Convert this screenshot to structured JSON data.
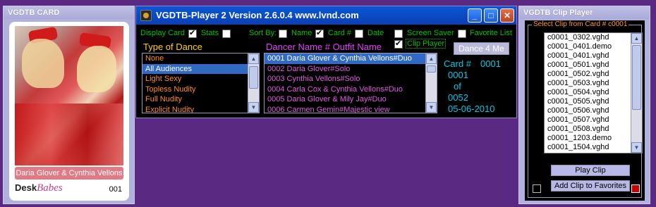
{
  "card_window": {
    "title": "VGDTB CARD",
    "caption": "Daria Glover & Cynthia Vellons",
    "logo_part1": "Desk",
    "logo_part2": "Babes",
    "card_number": "001"
  },
  "player_window": {
    "title": "VGDTB-Player 2  Version 2.6.0.4  www.lvnd.com",
    "controls": {
      "display_card": {
        "label": "Display Card",
        "checked": true
      },
      "stats": {
        "label": "Stats",
        "checked": false
      },
      "sort_by_label": "Sort By:",
      "sort_name": {
        "label": "Name",
        "checked": false
      },
      "sort_card": {
        "label": "Card #",
        "checked": true
      },
      "sort_date": {
        "label": "Date",
        "checked": false
      },
      "screen_saver": {
        "label": "Screen Saver",
        "checked": false
      },
      "favorite_list": {
        "label": "Favorite List",
        "checked": false
      },
      "clip_player": {
        "label": "Clip Player",
        "checked": true
      }
    },
    "type_of_dance": {
      "heading": "Type of Dance",
      "items": [
        "None",
        "All Audiences",
        "Light Sexy",
        "Topless Nudity",
        "Full Nudity",
        "Explicit Nudity"
      ],
      "selected_index": 1
    },
    "dancer_list": {
      "heading": "Dancer Name # Outfit Name",
      "items": [
        "0001 Daria Glover & Cynthia Vellons#Duo",
        "0002 Daria Glover#Solo",
        "0003 Cynthia Vellons#Solo",
        "0004 Carla Cox & Cynthia Vellons#Duo",
        "0005 Daria Glover & Mily Jay#Duo",
        "0006 Carmen Gemin#Majestic view"
      ],
      "selected_index": 0
    },
    "dance_button": "Dance 4 Me",
    "stats": {
      "card_label": "Card #",
      "card_value": "0001",
      "index_value": "0001",
      "of_label": "of",
      "total_value": "0052",
      "date": "05-06-2010"
    }
  },
  "clip_window": {
    "title": "VGDTB Clip Player",
    "group_title": "Select Clip from Card # c0001",
    "clips": [
      "c0001_0302.vghd",
      "c0001_0401.demo",
      "c0001_0401.vghd",
      "c0001_0501.vghd",
      "c0001_0502.vghd",
      "c0001_0503.vghd",
      "c0001_0504.vghd",
      "c0001_0505.vghd",
      "c0001_0506.vghd",
      "c0001_0507.vghd",
      "c0001_0508.vghd",
      "c0001_1203.demo",
      "c0001_1504.vghd"
    ],
    "play_button": "Play Clip",
    "add_favorites_button": "Add Clip to Favorites"
  },
  "colors": {
    "desktop_bg": "#5a2a82",
    "green_label": "#00c000",
    "yellow_heading": "#ffd000",
    "magenta_heading": "#e040ff",
    "cyan_stats": "#00c8e6",
    "orange_items": "#ff8c1a",
    "dancer_items": "#e05ce0",
    "selection": "#316ac5"
  }
}
